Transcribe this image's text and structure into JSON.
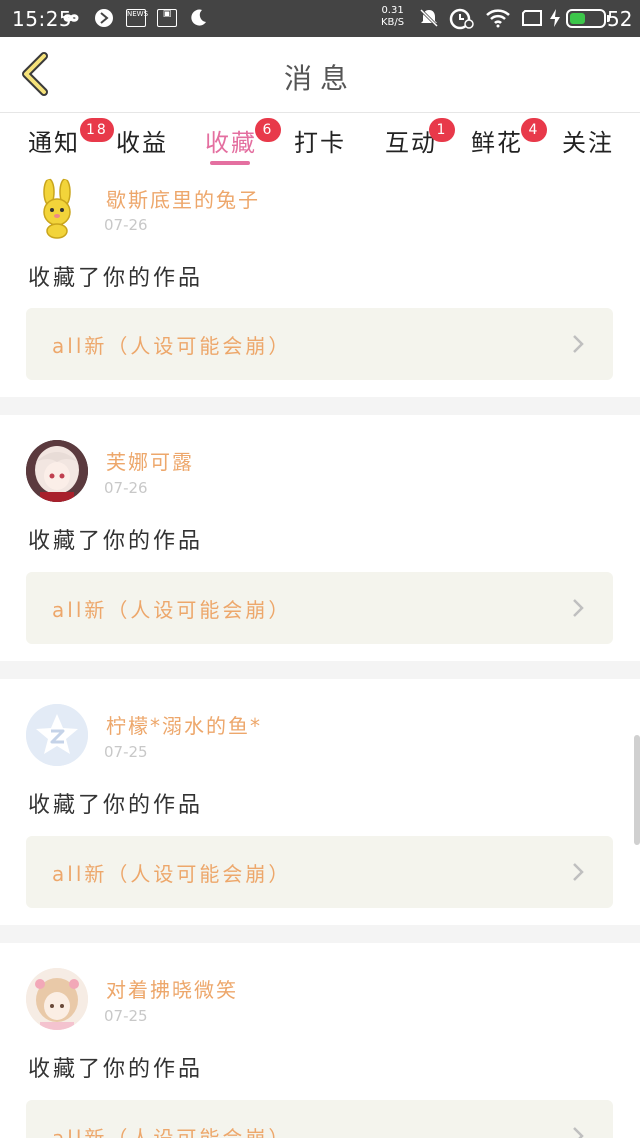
{
  "status_bar": {
    "time": "15:25",
    "net_speed_value": "0.31",
    "net_speed_unit": "KB/S",
    "news_icon_label": "NEWS",
    "battery_level": "52"
  },
  "header": {
    "title": "消息"
  },
  "tabs": [
    {
      "label": "通知",
      "badge": "18"
    },
    {
      "label": "收益",
      "badge": ""
    },
    {
      "label": "收藏",
      "badge": "6"
    },
    {
      "label": "打卡",
      "badge": ""
    },
    {
      "label": "互动",
      "badge": "1"
    },
    {
      "label": "鲜花",
      "badge": "4"
    },
    {
      "label": "关注",
      "badge": ""
    }
  ],
  "active_tab": "收藏",
  "notifications": [
    {
      "username": "歇斯底里的兔子",
      "date": "07-26",
      "action": "收藏了你的作品",
      "work_title": "all新（人设可能会崩）",
      "avatar": "bunny-avatar"
    },
    {
      "username": "芙娜可露",
      "date": "07-26",
      "action": "收藏了你的作品",
      "work_title": "all新（人设可能会崩）",
      "avatar": "girl-avatar"
    },
    {
      "username": "柠檬*溺水的鱼*",
      "date": "07-25",
      "action": "收藏了你的作品",
      "work_title": "all新（人设可能会崩）",
      "avatar": "qq-star-avatar"
    },
    {
      "username": "对着拂晓微笑",
      "date": "07-25",
      "action": "收藏了你的作品",
      "work_title": "all新（人设可能会崩）",
      "avatar": "anime-girl-avatar"
    }
  ],
  "colors": {
    "accent_pink": "#e46fa0",
    "username_orange": "#eda76b",
    "badge_red": "#e8394a",
    "work_box_bg": "#f4f4ed"
  }
}
